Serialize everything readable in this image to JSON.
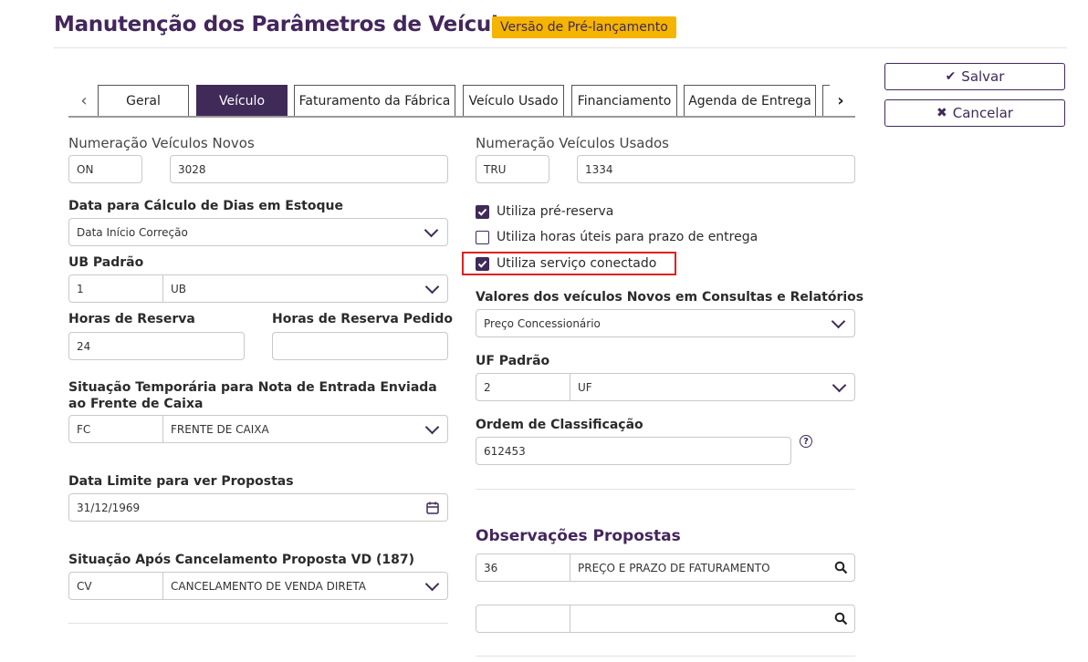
{
  "header": {
    "title": "Manutenção dos Parâmetros de Veículos",
    "badge": "Versão de Pré-lançamento"
  },
  "actions": {
    "save_label": "Salvar",
    "cancel_label": "Cancelar"
  },
  "tabs": [
    "Geral",
    "Veículo",
    "Faturamento da Fábrica",
    "Veículo Usado",
    "Financiamento",
    "Agenda de Entrega"
  ],
  "active_tab": "Veículo",
  "left": {
    "numeracao_novos": {
      "label": "Numeração Veículos Novos",
      "code": "ON",
      "value": "3028"
    },
    "data_calculo": {
      "label": "Data para Cálculo de Dias em Estoque",
      "value": "Data Início Correção"
    },
    "ub_padrao": {
      "label": "UB Padrão",
      "code": "1",
      "value": "UB"
    },
    "horas_reserva": {
      "label": "Horas de Reserva",
      "value": "24"
    },
    "horas_reserva_pedido": {
      "label": "Horas de Reserva Pedido",
      "value": ""
    },
    "situacao_temporaria": {
      "label": "Situação Temporária para Nota de Entrada Enviada ao Frente de Caixa",
      "code": "FC",
      "value": "FRENTE DE CAIXA"
    },
    "data_limite": {
      "label": "Data Limite para ver Propostas",
      "value": "31/12/1969"
    },
    "situacao_cancelamento": {
      "label": "Situação Após Cancelamento Proposta VD (187)",
      "code": "CV",
      "value": "CANCELAMENTO DE VENDA DIRETA"
    }
  },
  "right": {
    "numeracao_usados": {
      "label": "Numeração Veículos Usados",
      "code": "TRU",
      "value": "1334"
    },
    "checkboxes": [
      {
        "label": "Utiliza pré-reserva",
        "checked": true
      },
      {
        "label": "Utiliza horas úteis para prazo de entrega",
        "checked": false
      },
      {
        "label": "Utiliza serviço conectado",
        "checked": true
      }
    ],
    "valores_novos": {
      "label": "Valores dos veículos Novos em Consultas e Relatórios",
      "value": "Preço Concessionário"
    },
    "uf_padrao": {
      "label": "UF Padrão",
      "code": "2",
      "value": "UF"
    },
    "ordem_classificacao": {
      "label": "Ordem de Classificação",
      "value": "612453"
    },
    "observacoes": {
      "title": "Observações Propostas",
      "rows": [
        {
          "code": "36",
          "value": "PREÇO E PRAZO DE FATURAMENTO"
        },
        {
          "code": "",
          "value": ""
        }
      ]
    }
  },
  "colors": {
    "primary": "#3f2a58",
    "badge": "#f5b400",
    "highlight": "#e02020"
  }
}
